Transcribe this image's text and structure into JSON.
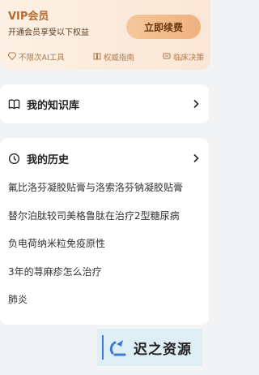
{
  "vip": {
    "title": "VIP会员",
    "subtitle": "开通会员享受以下权益",
    "renew_label": "立即续费",
    "features": [
      {
        "icon": "diamond-icon",
        "label": "不限次AI工具"
      },
      {
        "icon": "book-icon",
        "label": "权威指南"
      },
      {
        "icon": "clinic-icon",
        "label": "临床决策"
      }
    ]
  },
  "knowledge": {
    "title": "我的知识库"
  },
  "history": {
    "title": "我的历史",
    "items": [
      "氟比洛芬凝胶贴膏与洛索洛芬钠凝胶贴膏",
      "替尔泊肽较司美格鲁肽在治疗2型糖尿病",
      "负电荷纳米粒免疫原性",
      "3年的荨麻疹怎么治疗",
      "肺炎"
    ]
  },
  "watermark": {
    "text": "迟之资源"
  },
  "colors": {
    "accent": "#b8692c",
    "button": "#eeb17d",
    "background": "#f2f3f5"
  }
}
